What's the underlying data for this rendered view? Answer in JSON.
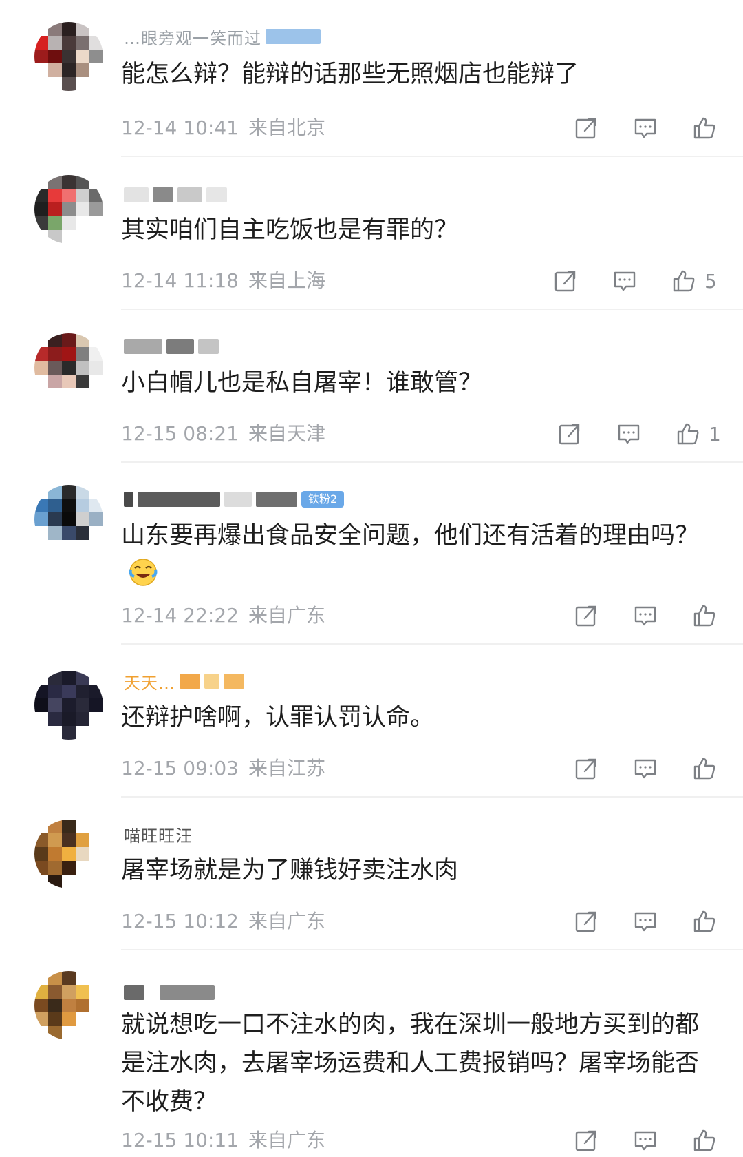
{
  "comments": [
    {
      "username": "…眼旁观一笑而过",
      "text": "能怎么辩？能辩的话那些无照烟店也能辩了",
      "time": "12-14 10:41",
      "location": "来自北京",
      "likes": "",
      "avatar_colors": [
        "#ffffff",
        "#8a7a7a",
        "#2a1f1f",
        "#c9c3c3",
        "#ffffff",
        "#d62020",
        "#b8b2b2",
        "#4a3a3a",
        "#7a6f6f",
        "#e0dede",
        "#9c1c1c",
        "#6e0e0e",
        "#3a3232",
        "#ecd9c9",
        "#8e8e8e",
        "#ffffff",
        "#d0b0a0",
        "#2c2424",
        "#a98f7f",
        "#ffffff",
        "#ffffff",
        "#ffffff",
        "#5a4f4f",
        "#ffffff",
        "#ffffff"
      ]
    },
    {
      "username": "",
      "text": "其实咱们自主吃饭也是有罪的？",
      "time": "12-14 11:18",
      "location": "来自上海",
      "likes": "5",
      "avatar_colors": [
        "#ffffff",
        "#7a7373",
        "#3a3333",
        "#555",
        "#ffffff",
        "#2a2a2a",
        "#e73a3a",
        "#f07070",
        "#cfcfcf",
        "#6a6a6a",
        "#1f1f1f",
        "#ba1f1f",
        "#8c8c8c",
        "#e8e8e8",
        "#9a9a9a",
        "#3a3a3a",
        "#7aa66a",
        "#e8e8e8",
        "#ffffff",
        "#ffffff",
        "#ffffff",
        "#c8c8c8",
        "#ffffff",
        "#ffffff",
        "#ffffff"
      ]
    },
    {
      "username": "",
      "text": "小白帽儿也是私自屠宰！谁敢管？",
      "time": "12-15 08:21",
      "location": "来自天津",
      "likes": "1",
      "avatar_colors": [
        "#ffffff",
        "#3a2020",
        "#6a1a1a",
        "#d9c7b0",
        "#ffffff",
        "#b72a2a",
        "#8c1c1c",
        "#a01515",
        "#7f7f7f",
        "#f0f0f0",
        "#e0bba0",
        "#6a5a5a",
        "#2a2a2a",
        "#c0c0c0",
        "#e8e8e8",
        "#ffffff",
        "#c9a5a5",
        "#e8c8b8",
        "#3a3a3a",
        "#ffffff",
        "#ffffff",
        "#ffffff",
        "#ffffff",
        "#ffffff",
        "#ffffff"
      ]
    },
    {
      "username": "",
      "badge": "铁粉2",
      "text": "山东要再爆出食品安全问题，他们还有活着的理由吗？",
      "time": "12-14 22:22",
      "location": "来自广东",
      "likes": "",
      "avatar_colors": [
        "#ffffff",
        "#8ab6d6",
        "#2a2a2a",
        "#c9d9e6",
        "#ffffff",
        "#3a78b5",
        "#2f5f8f",
        "#0f0f0f",
        "#b6cce0",
        "#dfe8f0",
        "#6aa0d0",
        "#2a3a50",
        "#0a0a0a",
        "#cfcfcf",
        "#9ab0c4",
        "#ffffff",
        "#9fb6c8",
        "#3a4a6a",
        "#2a2f3a",
        "#ffffff",
        "#ffffff",
        "#ffffff",
        "#ffffff",
        "#ffffff",
        "#ffffff"
      ]
    },
    {
      "username": "天天…",
      "text": "还辩护啥啊，认罪认罚认命。",
      "time": "12-15 09:03",
      "location": "来自江苏",
      "likes": "",
      "avatar_colors": [
        "#ffffff",
        "#2a2a3a",
        "#1a1a2a",
        "#3a3a55",
        "#ffffff",
        "#151525",
        "#2a2a44",
        "#3a3a5a",
        "#202030",
        "#1a1a2a",
        "#0f0f1a",
        "#454560",
        "#1c1c2c",
        "#2a2a3a",
        "#151525",
        "#ffffff",
        "#2a2a40",
        "#1a1a28",
        "#252535",
        "#ffffff",
        "#ffffff",
        "#ffffff",
        "#2a2a3a",
        "#ffffff",
        "#ffffff"
      ]
    },
    {
      "username": "喵旺旺汪",
      "text": "屠宰场就是为了赚钱好卖注水肉",
      "time": "12-15 10:12",
      "location": "来自广东",
      "likes": "",
      "avatar_colors": [
        "#ffffff",
        "#c08040",
        "#3a2a1a",
        "#ffffff",
        "#ffffff",
        "#8a5a2a",
        "#d09a50",
        "#4a3020",
        "#e0a040",
        "#ffffff",
        "#5a3a1a",
        "#c07a30",
        "#f0b040",
        "#e8d8c0",
        "#ffffff",
        "#7a4a20",
        "#a06a30",
        "#3a2010",
        "#ffffff",
        "#ffffff",
        "#ffffff",
        "#2a1a10",
        "#ffffff",
        "#ffffff",
        "#ffffff"
      ]
    },
    {
      "username": "",
      "text": "就说想吃一口不注水的肉，我在深圳一般地方买到的都是注水肉，去屠宰场运费和人工费报销吗？屠宰场能否不收费？",
      "time": "12-15 10:11",
      "location": "来自广东",
      "likes": "",
      "avatar_colors": [
        "#ffffff",
        "#c89048",
        "#5a3a20",
        "#ffffff",
        "#ffffff",
        "#e0b040",
        "#8a5a30",
        "#d0a060",
        "#f0c050",
        "#ffffff",
        "#7a4a20",
        "#3a2a1a",
        "#c08040",
        "#b07030",
        "#ffffff",
        "#d0a060",
        "#5a3a1a",
        "#e09a40",
        "#ffffff",
        "#ffffff",
        "#ffffff",
        "#9a6a30",
        "#ffffff",
        "#ffffff",
        "#ffffff"
      ]
    }
  ],
  "icon_names": [
    "share-icon",
    "comment-icon",
    "like-icon"
  ],
  "colors": {
    "text": "#1e1e1e",
    "meta": "#a3a6ab",
    "badge": "#6aa8e8",
    "icon": "#7d8085"
  }
}
